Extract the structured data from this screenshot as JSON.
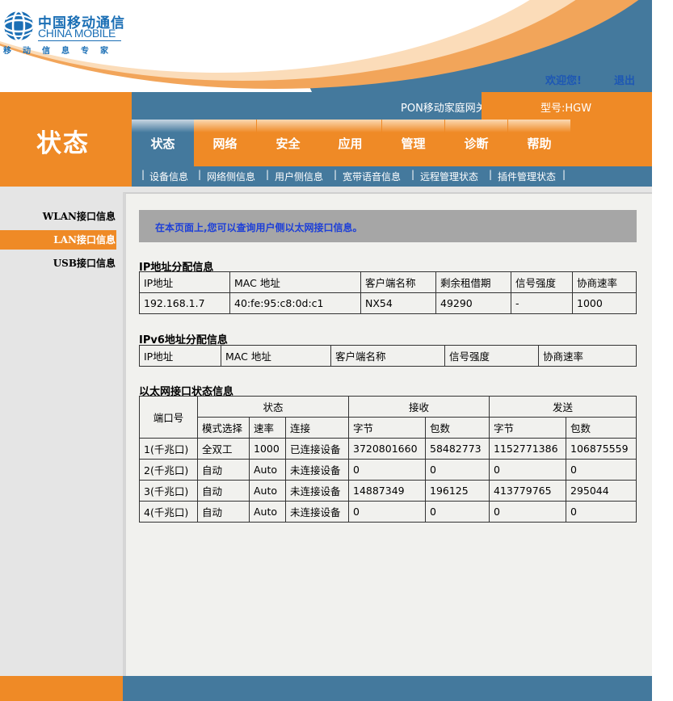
{
  "brand": {
    "name_cn": "中国移动通信",
    "name_en": "CHINA MOBILE",
    "slogan": "移动信息专家"
  },
  "header": {
    "welcome": "欢迎您!",
    "logout": "退出",
    "device_name": "PON移动家庭网关",
    "model": "型号:HGW"
  },
  "page_heading": "状态",
  "main_nav": [
    "状态",
    "网络",
    "安全",
    "应用",
    "管理",
    "诊断",
    "帮助"
  ],
  "sub_nav": [
    "设备信息",
    "网络侧信息",
    "用户侧信息",
    "宽带语音信息",
    "远程管理状态",
    "插件管理状态"
  ],
  "side_nav": [
    "WLAN接口信息",
    "LAN接口信息",
    "USB接口信息"
  ],
  "notice": "在本页面上,您可以查询用户侧以太网接口信息。",
  "ip_section": {
    "title": "IP地址分配信息",
    "headers": [
      "IP地址",
      "MAC 地址",
      "客户端名称",
      "剩余租借期",
      "信号强度",
      "协商速率"
    ],
    "rows": [
      [
        "192.168.1.7",
        "40:fe:95:c8:0d:c1",
        "NX54",
        "49290",
        "-",
        "1000"
      ]
    ]
  },
  "ipv6_section": {
    "title": "IPv6地址分配信息",
    "headers": [
      "IP地址",
      "MAC 地址",
      "客户端名称",
      "信号强度",
      "协商速率"
    ]
  },
  "eth_section": {
    "title": "以太网接口状态信息",
    "port_header": "端口号",
    "group_headers": [
      "状态",
      "接收",
      "发送"
    ],
    "sub_headers": [
      "模式选择",
      "速率",
      "连接",
      "字节",
      "包数",
      "字节",
      "包数"
    ],
    "rows": [
      [
        "1(千兆口)",
        "全双工",
        "1000",
        "已连接设备",
        "3720801660",
        "58482773",
        "1152771386",
        "106875559"
      ],
      [
        "2(千兆口)",
        "自动",
        "Auto",
        "未连接设备",
        "0",
        "0",
        "0",
        "0"
      ],
      [
        "3(千兆口)",
        "自动",
        "Auto",
        "未连接设备",
        "14887349",
        "196125",
        "413779765",
        "295044"
      ],
      [
        "4(千兆口)",
        "自动",
        "Auto",
        "未连接设备",
        "0",
        "0",
        "0",
        "0"
      ]
    ]
  },
  "colors": {
    "orange": "#ef8a26",
    "blue": "#44799d",
    "link_blue": "#1d57b4",
    "notice_text": "#1d3fd8"
  }
}
